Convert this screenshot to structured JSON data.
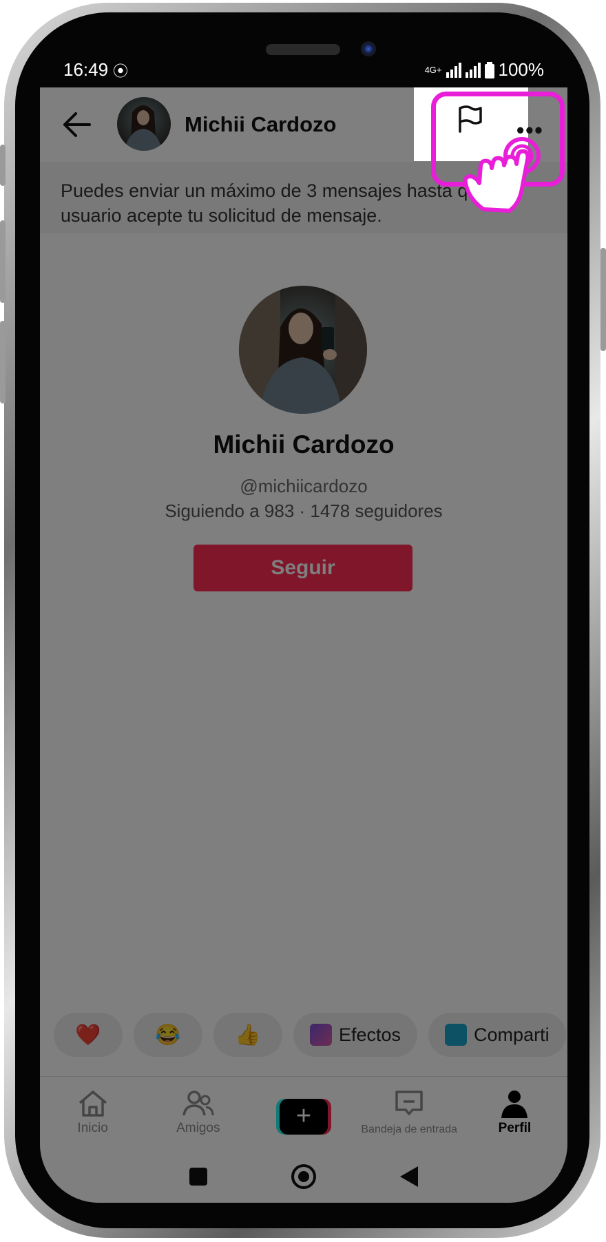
{
  "status_bar": {
    "time": "16:49",
    "network": "4G+",
    "battery": "100%"
  },
  "header": {
    "name": "Michii Cardozo"
  },
  "notice": {
    "text": "Puedes enviar un máximo de 3 mensajes hasta que el usuario acepte tu solicitud de mensaje."
  },
  "profile": {
    "name": "Michii Cardozo",
    "handle": "@michiicardozo",
    "stats": "Siguiendo a 983 · 1478 seguidores",
    "follow_label": "Seguir"
  },
  "quick_replies": [
    {
      "label": "❤️"
    },
    {
      "label": "😂"
    },
    {
      "label": "👍"
    },
    {
      "label": "Efectos"
    },
    {
      "label": "Comparti"
    }
  ],
  "bottom_nav": [
    {
      "label": "Inicio"
    },
    {
      "label": "Amigos"
    },
    {
      "label": "Bandeja de entrada"
    },
    {
      "label": "Perfil"
    }
  ],
  "colors": {
    "accent": "#fe2c55",
    "highlight": "#e81ed8",
    "overlay": "rgba(0,0,0,0.5)"
  }
}
